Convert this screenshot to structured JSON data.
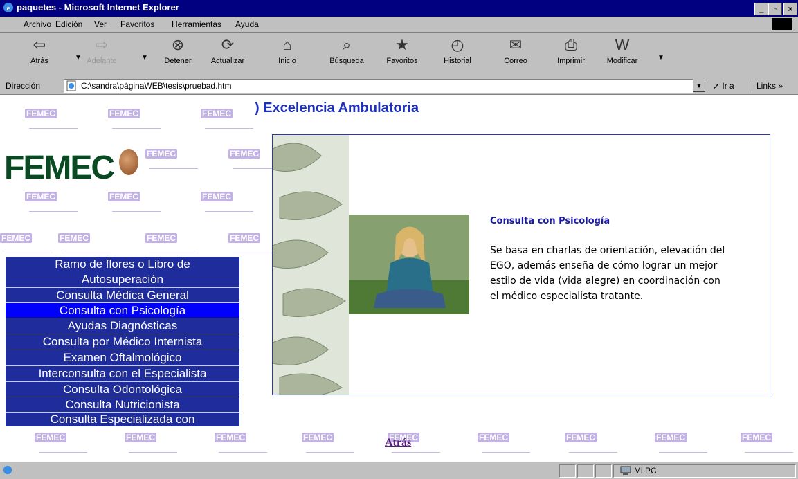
{
  "window": {
    "title": "paquetes - Microsoft Internet Explorer",
    "min": "_",
    "max": "▫",
    "close": "×"
  },
  "menu": [
    "Archivo",
    "Edición",
    "Ver",
    "Favoritos",
    "Herramientas",
    "Ayuda"
  ],
  "toolbar": {
    "back": "Atrás",
    "forward": "Adelante",
    "stop": "Detener",
    "refresh": "Actualizar",
    "home": "Inicio",
    "search": "Búsqueda",
    "favorites": "Favoritos",
    "history": "Historial",
    "mail": "Correo",
    "print": "Imprimir",
    "edit": "Modificar"
  },
  "address": {
    "label": "Dirección",
    "url": "C:\\sandra\\páginaWEB\\tesis\\pruebad.htm",
    "go": "Ir a",
    "links": "Links »"
  },
  "page": {
    "heading": ") Excelencia Ambulatoria",
    "logo": "FEMEC",
    "watermark": "FEMEC",
    "nav": [
      "Ramo de flores o Libro de",
      "Autosuperación",
      "Consulta Médica General",
      "Consulta con Psicología",
      "Ayudas Diagnósticas",
      "Consulta por Médico Internista",
      "Examen Oftalmológico",
      "Interconsulta con el Especialista",
      "Consulta Odontológica",
      "Consulta Nutricionista",
      "Consulta Especializada con"
    ],
    "nav_active_index": 3,
    "panel": {
      "title": "Consulta con Psicología",
      "text": "Se basa en charlas de orientación, elevación del EGO, además enseña de cómo lograr un mejor estilo de vida (vida alegre) en coordinación con el médico especialista tratante."
    },
    "back_link": "Atrás"
  },
  "status": {
    "zone": "Mi PC"
  },
  "colors": {
    "titlebar": "#000080",
    "nav_bg": "#1e2c9c",
    "nav_active": "#0000ff",
    "heading": "#1d2fbd",
    "link": "#5a1a80"
  }
}
